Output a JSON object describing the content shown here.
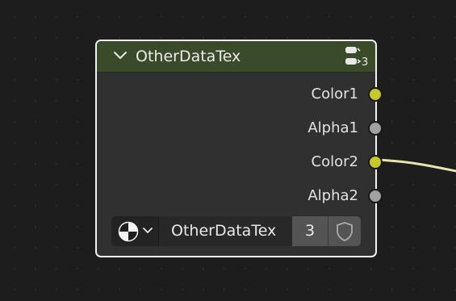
{
  "node": {
    "title": "OtherDataTex",
    "users_count": "3",
    "header_color": "#3a4b2a",
    "border_color": "#f2f2f2",
    "icons": {
      "collapse": "chevron-down-icon",
      "users": "users-icon",
      "texture": "texture-checker-icon",
      "dropdown": "chevron-down-icon",
      "fake_user": "shield-icon"
    },
    "outputs": [
      {
        "label": "Color1",
        "type": "color",
        "socket_color": "#c7c729",
        "linked": false
      },
      {
        "label": "Alpha1",
        "type": "value",
        "socket_color": "#a1a1a1",
        "linked": false
      },
      {
        "label": "Color2",
        "type": "color",
        "socket_color": "#c7c729",
        "linked": true
      },
      {
        "label": "Alpha2",
        "type": "value",
        "socket_color": "#a1a1a1",
        "linked": false
      }
    ],
    "data_block": {
      "name": "OtherDataTex",
      "user_count": "3"
    }
  },
  "link": {
    "color": "#e8e6b0"
  }
}
